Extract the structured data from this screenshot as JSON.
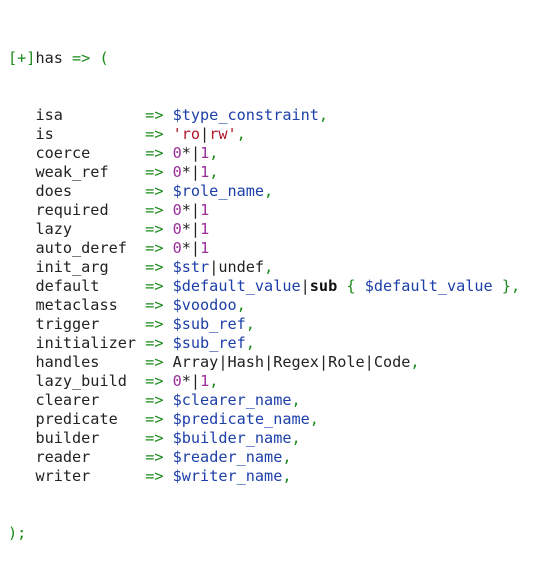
{
  "header": {
    "toggle": "[+]",
    "keyword": "has",
    "arrow": " => ",
    "open": "("
  },
  "closing": ");",
  "attributes": [
    {
      "key": "isa",
      "arrow": "=> ",
      "parts": [
        {
          "t": "var",
          "v": "$type_constraint"
        },
        {
          "t": "green",
          "v": ","
        }
      ]
    },
    {
      "key": "is",
      "arrow": "=> ",
      "parts": [
        {
          "t": "str",
          "v": "'ro"
        },
        {
          "t": "sep",
          "v": "|"
        },
        {
          "t": "str",
          "v": "rw'"
        },
        {
          "t": "green",
          "v": ","
        }
      ]
    },
    {
      "key": "coerce",
      "arrow": "=> ",
      "parts": [
        {
          "t": "num",
          "v": "0"
        },
        {
          "t": "plain",
          "v": "*"
        },
        {
          "t": "sep",
          "v": "|"
        },
        {
          "t": "num",
          "v": "1"
        },
        {
          "t": "green",
          "v": ","
        }
      ]
    },
    {
      "key": "weak_ref",
      "arrow": "=> ",
      "parts": [
        {
          "t": "num",
          "v": "0"
        },
        {
          "t": "plain",
          "v": "*"
        },
        {
          "t": "sep",
          "v": "|"
        },
        {
          "t": "num",
          "v": "1"
        },
        {
          "t": "green",
          "v": ","
        }
      ]
    },
    {
      "key": "does",
      "arrow": "=> ",
      "parts": [
        {
          "t": "var",
          "v": "$role_name"
        },
        {
          "t": "green",
          "v": ","
        }
      ]
    },
    {
      "key": "required",
      "arrow": "=> ",
      "parts": [
        {
          "t": "num",
          "v": "0"
        },
        {
          "t": "plain",
          "v": "*"
        },
        {
          "t": "sep",
          "v": "|"
        },
        {
          "t": "num",
          "v": "1"
        }
      ]
    },
    {
      "key": "lazy",
      "arrow": "=> ",
      "parts": [
        {
          "t": "num",
          "v": "0"
        },
        {
          "t": "plain",
          "v": "*"
        },
        {
          "t": "sep",
          "v": "|"
        },
        {
          "t": "num",
          "v": "1"
        }
      ]
    },
    {
      "key": "auto_deref",
      "arrow": "=> ",
      "parts": [
        {
          "t": "num",
          "v": "0"
        },
        {
          "t": "plain",
          "v": "*"
        },
        {
          "t": "sep",
          "v": "|"
        },
        {
          "t": "num",
          "v": "1"
        }
      ]
    },
    {
      "key": "init_arg",
      "arrow": "=> ",
      "parts": [
        {
          "t": "var",
          "v": "$str"
        },
        {
          "t": "sep",
          "v": "|"
        },
        {
          "t": "plain",
          "v": "undef"
        },
        {
          "t": "green",
          "v": ","
        }
      ]
    },
    {
      "key": "default",
      "arrow": "=> ",
      "parts": [
        {
          "t": "var",
          "v": "$default_value"
        },
        {
          "t": "sep",
          "v": "|"
        },
        {
          "t": "kw",
          "v": "sub"
        },
        {
          "t": "plain",
          "v": " "
        },
        {
          "t": "brace",
          "v": "{"
        },
        {
          "t": "plain",
          "v": " "
        },
        {
          "t": "var",
          "v": "$default_value"
        },
        {
          "t": "plain",
          "v": " "
        },
        {
          "t": "brace",
          "v": "}"
        },
        {
          "t": "green",
          "v": ","
        }
      ]
    },
    {
      "key": "metaclass",
      "arrow": "=> ",
      "parts": [
        {
          "t": "var",
          "v": "$voodoo"
        },
        {
          "t": "green",
          "v": ","
        }
      ]
    },
    {
      "key": "trigger",
      "arrow": "=> ",
      "parts": [
        {
          "t": "var",
          "v": "$sub_ref"
        },
        {
          "t": "green",
          "v": ","
        }
      ]
    },
    {
      "key": "initializer",
      "arrow": "=> ",
      "parts": [
        {
          "t": "var",
          "v": "$sub_ref"
        },
        {
          "t": "green",
          "v": ","
        }
      ]
    },
    {
      "key": "handles",
      "arrow": "=> ",
      "parts": [
        {
          "t": "plain",
          "v": "Array"
        },
        {
          "t": "sep",
          "v": "|"
        },
        {
          "t": "plain",
          "v": "Hash"
        },
        {
          "t": "sep",
          "v": "|"
        },
        {
          "t": "plain",
          "v": "Regex"
        },
        {
          "t": "sep",
          "v": "|"
        },
        {
          "t": "plain",
          "v": "Role"
        },
        {
          "t": "sep",
          "v": "|"
        },
        {
          "t": "plain",
          "v": "Code"
        },
        {
          "t": "green",
          "v": ","
        }
      ]
    },
    {
      "key": "lazy_build",
      "arrow": "=> ",
      "parts": [
        {
          "t": "num",
          "v": "0"
        },
        {
          "t": "plain",
          "v": "*"
        },
        {
          "t": "sep",
          "v": "|"
        },
        {
          "t": "num",
          "v": "1"
        },
        {
          "t": "green",
          "v": ","
        }
      ]
    },
    {
      "key": "clearer",
      "arrow": "=> ",
      "parts": [
        {
          "t": "var",
          "v": "$clearer_name"
        },
        {
          "t": "green",
          "v": ","
        }
      ]
    },
    {
      "key": "predicate",
      "arrow": "=> ",
      "parts": [
        {
          "t": "var",
          "v": "$predicate_name"
        },
        {
          "t": "green",
          "v": ","
        }
      ]
    },
    {
      "key": "builder",
      "arrow": "=> ",
      "parts": [
        {
          "t": "var",
          "v": "$builder_name"
        },
        {
          "t": "green",
          "v": ","
        }
      ]
    },
    {
      "key": "reader",
      "arrow": "=> ",
      "parts": [
        {
          "t": "var",
          "v": "$reader_name"
        },
        {
          "t": "green",
          "v": ","
        }
      ]
    },
    {
      "key": "writer",
      "arrow": "=> ",
      "parts": [
        {
          "t": "var",
          "v": "$writer_name"
        },
        {
          "t": "green",
          "v": ","
        }
      ]
    }
  ],
  "colors": {
    "green": "#1a8a1a",
    "variable": "#1c3fa8",
    "string": "#b2182b",
    "number": "#9b2d9b",
    "text": "#222222"
  }
}
